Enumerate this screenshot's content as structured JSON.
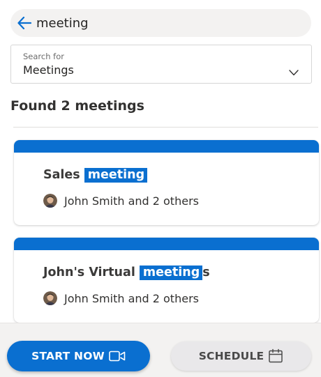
{
  "search": {
    "query": "meeting",
    "back_icon": "arrow-left-icon"
  },
  "filter": {
    "label": "Search for",
    "selected": "Meetings",
    "chevron_icon": "chevron-down-icon"
  },
  "results": {
    "heading": "Found 2 meetings",
    "items": [
      {
        "title_prefix": "Sales ",
        "title_match": "meeting",
        "title_suffix": "",
        "attendees": "John Smith and 2 others"
      },
      {
        "title_prefix": "John's Virtual ",
        "title_match": "meeting",
        "title_suffix": "s",
        "attendees": "John Smith and 2 others"
      }
    ]
  },
  "actions": {
    "start_now": "START NOW",
    "start_now_icon": "video-camera-icon",
    "schedule": "SCHEDULE",
    "schedule_icon": "calendar-icon"
  },
  "colors": {
    "accent": "#0a6fd0",
    "highlight_text": "#ffffff",
    "bar_background": "#f3f2f1"
  }
}
